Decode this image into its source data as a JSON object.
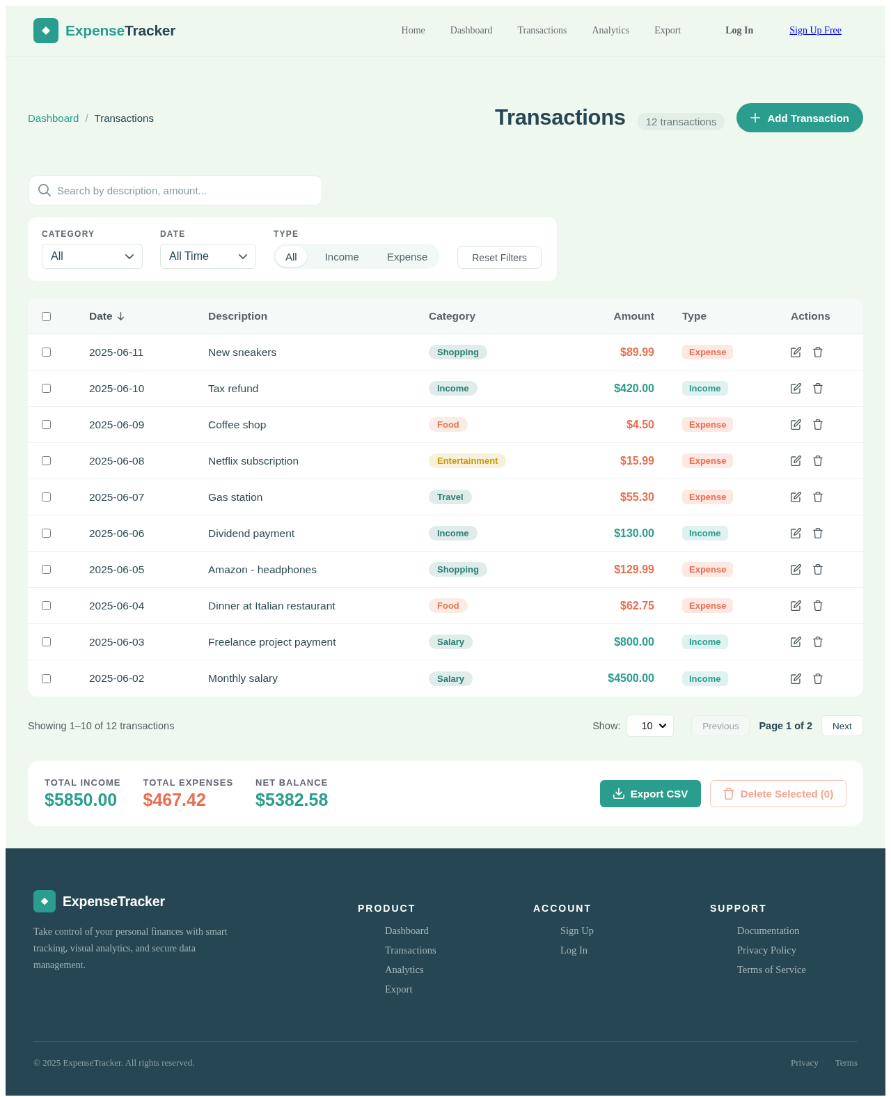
{
  "header": {
    "logo": {
      "parts": [
        "Expense",
        "Tracker"
      ]
    },
    "nav": [
      "Home",
      "Dashboard",
      "Transactions",
      "Analytics",
      "Export"
    ],
    "login": "Log In",
    "signup": "Sign Up Free"
  },
  "breadcrumb": {
    "items": [
      {
        "label": "Dashboard",
        "kind": "link"
      },
      {
        "label": "Transactions",
        "kind": "current"
      }
    ],
    "separator": "/"
  },
  "page": {
    "title": "Transactions",
    "count": "12 transactions",
    "add_button": "Add Transaction"
  },
  "search": {
    "placeholder": "Search by description, amount..."
  },
  "filters": {
    "category": {
      "label": "CATEGORY",
      "value": "All"
    },
    "date": {
      "label": "DATE",
      "value": "All Time"
    },
    "type": {
      "label": "TYPE",
      "options": [
        {
          "label": "All",
          "selected": true
        },
        {
          "label": "Income",
          "selected": false
        },
        {
          "label": "Expense",
          "selected": false
        }
      ]
    },
    "reset": "Reset Filters"
  },
  "table": {
    "select_all": {
      "checked": false
    },
    "columns": [
      {
        "label": "Date",
        "sorted": true
      },
      {
        "label": "Description",
        "sorted": false
      },
      {
        "label": "Category",
        "sorted": false
      },
      {
        "label": "Amount",
        "sorted": false
      },
      {
        "label": "Type",
        "sorted": false
      },
      {
        "label": "Actions",
        "sorted": false
      }
    ],
    "rows": [
      {
        "checked": false,
        "date": "2025-06-11",
        "description": "New sneakers",
        "category": {
          "label": "Shopping",
          "color": "#2a7f73"
        },
        "amount": "$89.99",
        "type": "Expense",
        "kind": "expense"
      },
      {
        "checked": false,
        "date": "2025-06-10",
        "description": "Tax refund",
        "category": {
          "label": "Income",
          "color": "#2a7f73"
        },
        "amount": "$420.00",
        "type": "Income",
        "kind": "income"
      },
      {
        "checked": false,
        "date": "2025-06-09",
        "description": "Coffee shop",
        "category": {
          "label": "Food",
          "color": "#e07b53"
        },
        "amount": "$4.50",
        "type": "Expense",
        "kind": "expense"
      },
      {
        "checked": false,
        "date": "2025-06-08",
        "description": "Netflix subscription",
        "category": {
          "label": "Entertainment",
          "color": "#c99a06"
        },
        "amount": "$15.99",
        "type": "Expense",
        "kind": "expense"
      },
      {
        "checked": false,
        "date": "2025-06-07",
        "description": "Gas station",
        "category": {
          "label": "Travel",
          "color": "#2a7f73"
        },
        "amount": "$55.30",
        "type": "Expense",
        "kind": "expense"
      },
      {
        "checked": false,
        "date": "2025-06-06",
        "description": "Dividend payment",
        "category": {
          "label": "Income",
          "color": "#2a7f73"
        },
        "amount": "$130.00",
        "type": "Income",
        "kind": "income"
      },
      {
        "checked": false,
        "date": "2025-06-05",
        "description": "Amazon - headphones",
        "category": {
          "label": "Shopping",
          "color": "#2a7f73"
        },
        "amount": "$129.99",
        "type": "Expense",
        "kind": "expense"
      },
      {
        "checked": false,
        "date": "2025-06-04",
        "description": "Dinner at Italian restaurant",
        "category": {
          "label": "Food",
          "color": "#e07b53"
        },
        "amount": "$62.75",
        "type": "Expense",
        "kind": "expense"
      },
      {
        "checked": false,
        "date": "2025-06-03",
        "description": "Freelance project payment",
        "category": {
          "label": "Salary",
          "color": "#2a7f73"
        },
        "amount": "$800.00",
        "type": "Income",
        "kind": "income"
      },
      {
        "checked": false,
        "date": "2025-06-02",
        "description": "Monthly salary",
        "category": {
          "label": "Salary",
          "color": "#2a7f73"
        },
        "amount": "$4500.00",
        "type": "Income",
        "kind": "income"
      }
    ]
  },
  "pagination": {
    "summary": "Showing 1–10 of 12 transactions",
    "show_label": "Show:",
    "page_size": "10",
    "previous": {
      "label": "Previous",
      "disabled": true
    },
    "page": "Page 1 of 2",
    "next": {
      "label": "Next",
      "disabled": false
    }
  },
  "summary": {
    "stats": [
      {
        "label": "TOTAL INCOME",
        "value": "$5850.00",
        "kind": "positive"
      },
      {
        "label": "TOTAL EXPENSES",
        "value": "$467.42",
        "kind": "negative"
      },
      {
        "label": "NET BALANCE",
        "value": "$5382.58",
        "kind": "positive"
      }
    ],
    "export": "Export CSV",
    "delete": {
      "label": "Delete Selected (0)",
      "disabled": true
    }
  },
  "footer": {
    "brand": "ExpenseTracker",
    "description": "Take control of your personal finances with smart tracking, visual analytics, and secure data management.",
    "columns": [
      {
        "title": "PRODUCT",
        "links": [
          "Dashboard",
          "Transactions",
          "Analytics",
          "Export"
        ]
      },
      {
        "title": "ACCOUNT",
        "links": [
          "Sign Up",
          "Log In"
        ]
      },
      {
        "title": "SUPPORT",
        "links": [
          "Documentation",
          "Privacy Policy",
          "Terms of Service"
        ]
      }
    ],
    "copyright": "© 2025 ExpenseTracker. All rights reserved.",
    "bottom_links": [
      "Privacy",
      "Terms"
    ]
  }
}
